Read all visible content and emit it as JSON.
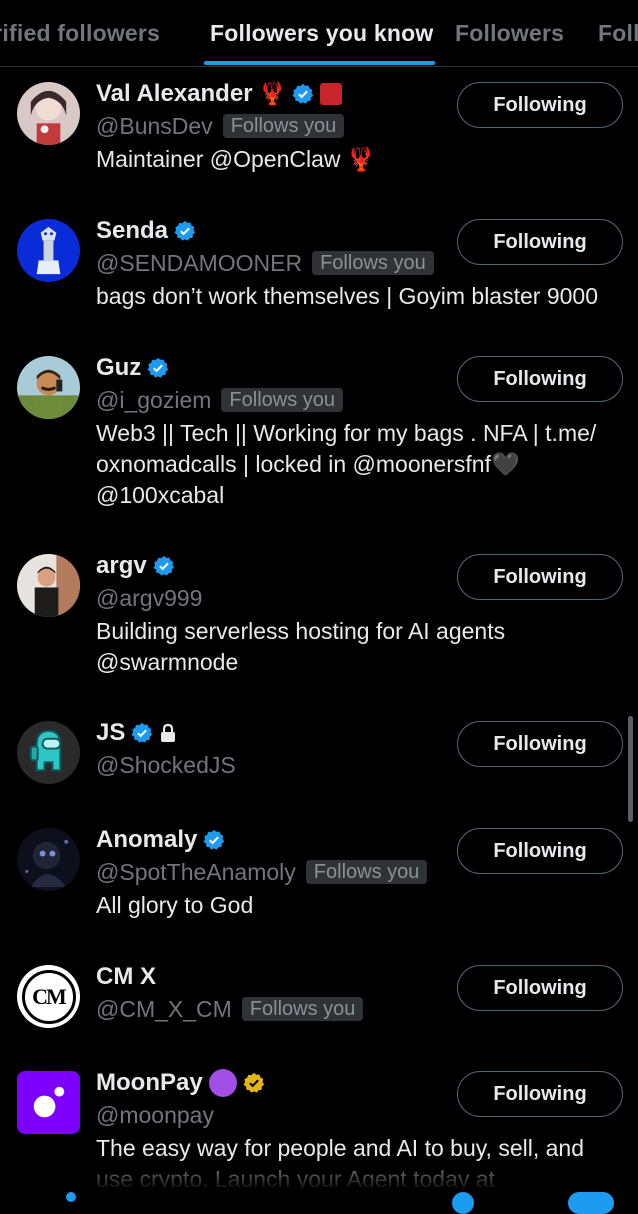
{
  "tabs": [
    {
      "label": "Verified followers",
      "active": false
    },
    {
      "label": "Followers you know",
      "active": true
    },
    {
      "label": "Followers",
      "active": false
    },
    {
      "label": "Following",
      "active": false
    }
  ],
  "colors": {
    "background": "#000000",
    "accent": "#1d9bf0",
    "gold_check": "#e2b719",
    "muted": "#71767b"
  },
  "users": [
    {
      "name": "Val Alexander",
      "handle": "@BunsDev",
      "follows_you": "Follows you",
      "bio": "Maintainer @OpenClaw 🦞",
      "verified": "blue",
      "extra_icons": [
        "lobster-emoji",
        "brand-badge-icon"
      ],
      "button": "Following"
    },
    {
      "name": "Senda",
      "handle": "@SENDAMOONER",
      "follows_you": "Follows you",
      "bio": "bags don’t work themselves | Goyim blaster 9000",
      "verified": "blue",
      "button": "Following"
    },
    {
      "name": "Guz",
      "handle": "@i_goziem",
      "follows_you": "Follows you",
      "bio": "Web3 || Tech || Working for my bags . NFA | t.me/ oxnomadcalls | locked in @moonersfnf🖤 @100xcabal",
      "verified": "blue",
      "button": "Following"
    },
    {
      "name": "argv",
      "handle": "@argv999",
      "follows_you": "",
      "bio": "Building serverless hosting for AI agents @swarmnode",
      "verified": "blue",
      "button": "Following"
    },
    {
      "name": "JS",
      "handle": "@ShockedJS",
      "follows_you": "",
      "bio": "",
      "verified": "blue",
      "extra_icons": [
        "lock-icon"
      ],
      "button": "Following"
    },
    {
      "name": "Anomaly",
      "handle": "@SpotTheAnamoly",
      "follows_you": "Follows you",
      "bio": "All glory to God",
      "verified": "blue",
      "button": "Following"
    },
    {
      "name": "CM X",
      "handle": "@CM_X_CM",
      "follows_you": "Follows you",
      "bio": "",
      "verified": "none",
      "avatar_text": "CM",
      "button": "Following"
    },
    {
      "name": "MoonPay",
      "handle": "@moonpay",
      "follows_you": "",
      "bio": "The easy way for people and AI to buy, sell, and use crypto. Launch your Agent today at",
      "verified": "gold",
      "extra_icons": [
        "purple-circle-emoji"
      ],
      "button": "Following"
    }
  ]
}
